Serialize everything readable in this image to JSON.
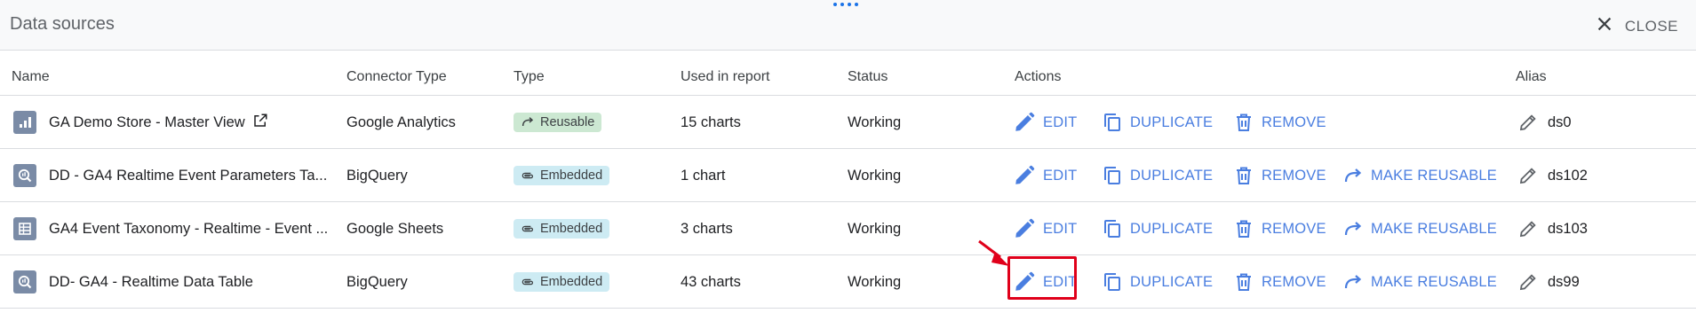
{
  "panel": {
    "title": "Data sources",
    "close_label": "CLOSE"
  },
  "columns": {
    "name": "Name",
    "connector": "Connector Type",
    "type": "Type",
    "used": "Used in report",
    "status": "Status",
    "actions": "Actions",
    "alias": "Alias"
  },
  "action_labels": {
    "edit": "EDIT",
    "duplicate": "DUPLICATE",
    "remove": "REMOVE",
    "make_reusable": "MAKE REUSABLE"
  },
  "rows": [
    {
      "name": "GA Demo Store - Master View",
      "icon": "analytics-icon",
      "external_link": true,
      "connector": "Google Analytics",
      "type": "Reusable",
      "used": "15 charts",
      "status": "Working",
      "alias": "ds0",
      "make_reusable": false
    },
    {
      "name": "DD - GA4 Realtime Event Parameters Ta...",
      "icon": "bigquery-icon",
      "external_link": false,
      "connector": "BigQuery",
      "type": "Embedded",
      "used": "1 chart",
      "status": "Working",
      "alias": "ds102",
      "make_reusable": true
    },
    {
      "name": "GA4 Event Taxonomy - Realtime - Event ...",
      "icon": "sheets-icon",
      "external_link": false,
      "connector": "Google Sheets",
      "type": "Embedded",
      "used": "3 charts",
      "status": "Working",
      "alias": "ds103",
      "make_reusable": true
    },
    {
      "name": "DD- GA4 - Realtime Data Table",
      "icon": "bigquery-icon",
      "external_link": false,
      "connector": "BigQuery",
      "type": "Embedded",
      "used": "43 charts",
      "status": "Working",
      "alias": "ds99",
      "make_reusable": true
    }
  ],
  "colors": {
    "action_blue": "#4a7ee0",
    "reusable_chip": "#cce8d2",
    "embedded_chip": "#cdebf3",
    "highlight_red": "#e0001a"
  }
}
